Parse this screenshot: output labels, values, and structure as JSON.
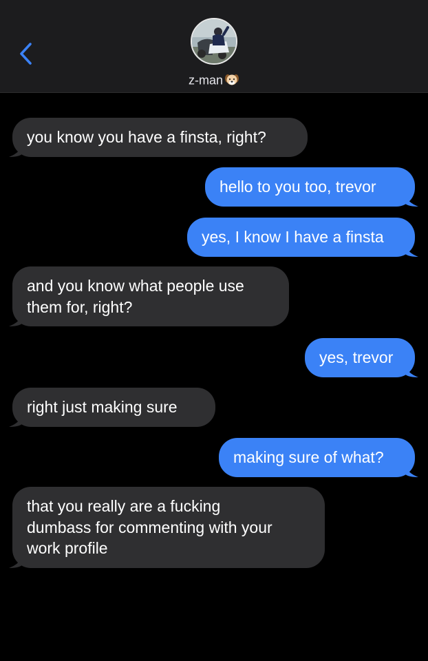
{
  "header": {
    "contact_name": "z-man",
    "contact_emoji_icon": "dog-face-icon",
    "back_icon": "chevron-left-icon",
    "accent_color": "#3b82f6"
  },
  "messages": [
    {
      "direction": "incoming",
      "lines": [
        "you know you have a finsta, right?"
      ]
    },
    {
      "direction": "outgoing",
      "lines": [
        "hello to you too, trevor"
      ]
    },
    {
      "direction": "outgoing",
      "lines": [
        "yes, I know I have a finsta"
      ]
    },
    {
      "direction": "incoming",
      "lines": [
        "and you know what people use",
        "them for, right?"
      ]
    },
    {
      "direction": "outgoing",
      "lines": [
        "yes, trevor"
      ]
    },
    {
      "direction": "incoming",
      "lines": [
        "right just making sure"
      ]
    },
    {
      "direction": "outgoing",
      "lines": [
        "making sure of what?"
      ]
    },
    {
      "direction": "incoming",
      "lines": [
        "that you really are a fucking",
        "dumbass for commenting with your",
        "work profile"
      ]
    }
  ],
  "colors": {
    "incoming_bubble": "#2f2f31",
    "outgoing_bubble": "#3b82f6",
    "background": "#000000",
    "header_background": "#1c1c1e"
  }
}
